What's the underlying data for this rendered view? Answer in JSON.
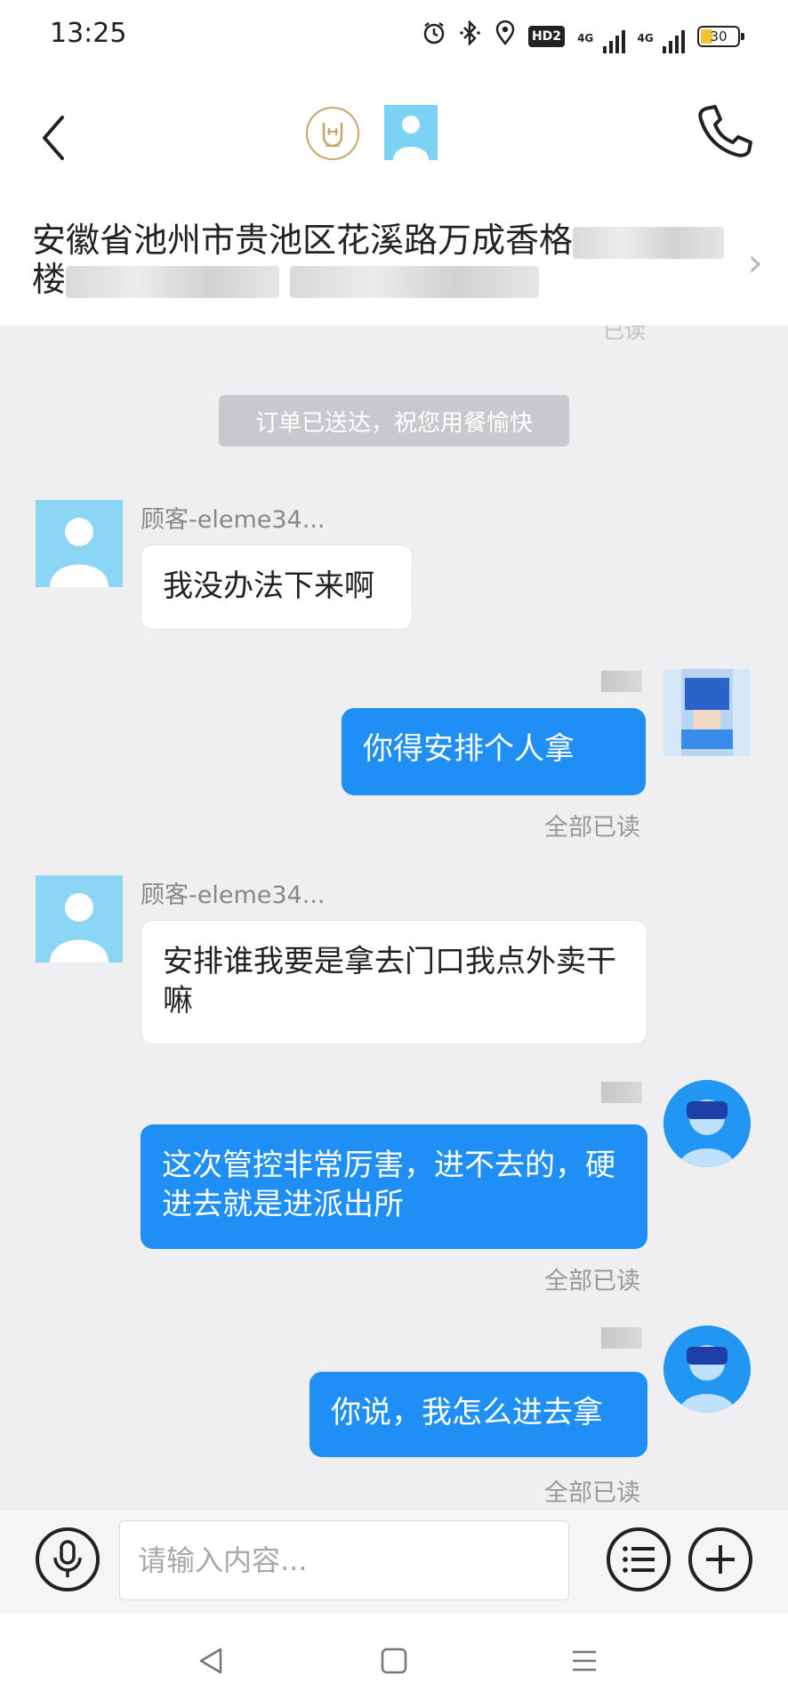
{
  "status_bar": {
    "time": "13:25",
    "icons": [
      "alarm-icon",
      "bluetooth-icon",
      "location-icon",
      "hd-icon",
      "signal-4g-icon",
      "signal-4g-icon",
      "battery-icon"
    ],
    "hd_label": "HD2",
    "network_1": "4G",
    "network_2": "4G",
    "battery_level": "30"
  },
  "header": {
    "address_line1": "安徽省池州市贵池区花溪路万成香格",
    "address_line2": "楼"
  },
  "chat": {
    "faint_read": "已读",
    "system_message": "订单已送达，祝您用餐愉快",
    "messages": [
      {
        "from": "customer",
        "name": "顾客-eleme34...",
        "text": "我没办法下来啊"
      },
      {
        "from": "rider",
        "text": "你得安排个人拿",
        "status": "全部已读"
      },
      {
        "from": "customer",
        "name": "顾客-eleme34...",
        "text": "安排谁我要是拿去门口我点外卖干嘛"
      },
      {
        "from": "rider",
        "text": "这次管控非常厉害，进不去的，硬进去就是进派出所",
        "status": "全部已读"
      },
      {
        "from": "rider",
        "text": "你说，我怎么进去拿",
        "status": "全部已读"
      }
    ]
  },
  "input_bar": {
    "placeholder": "请输入内容..."
  },
  "colors": {
    "bubble_out": "#1f8ef5",
    "chat_bg": "#efeff2",
    "system_pill": "#c9c9cd"
  }
}
